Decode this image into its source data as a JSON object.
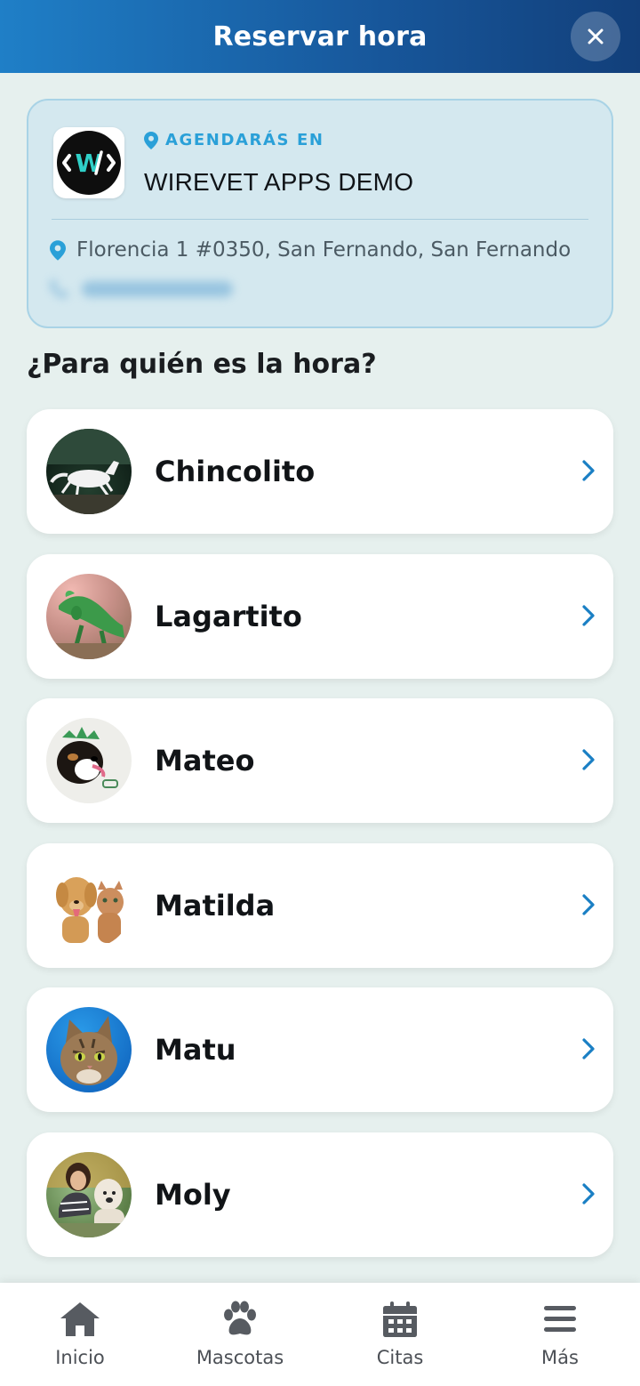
{
  "header": {
    "title": "Reservar hora",
    "close_icon": "close-icon"
  },
  "clinic": {
    "label": "AGENDARÁS EN",
    "name": "WIREVET APPS DEMO",
    "address": "Florencia 1 #0350, San Fernando, San Fernando",
    "logo_text": "W",
    "accent_color": "#2aa0d8"
  },
  "question": "¿Para quién es la hora?",
  "pets": [
    {
      "name": "Chincolito",
      "avatar": "horse-photo"
    },
    {
      "name": "Lagartito",
      "avatar": "iguana-photo"
    },
    {
      "name": "Mateo",
      "avatar": "dog-photo"
    },
    {
      "name": "Matilda",
      "avatar": "dog-and-cat-photo"
    },
    {
      "name": "Matu",
      "avatar": "cat-photo"
    },
    {
      "name": "Moly",
      "avatar": "woman-with-dog-photo"
    }
  ],
  "tabbar": {
    "items": [
      {
        "label": "Inicio",
        "icon": "home-icon"
      },
      {
        "label": "Mascotas",
        "icon": "paw-icon"
      },
      {
        "label": "Citas",
        "icon": "calendar-icon"
      },
      {
        "label": "Más",
        "icon": "menu-icon"
      }
    ]
  },
  "colors": {
    "header_start": "#1f7fc7",
    "header_end": "#123f7a",
    "chevron": "#1a7fc4",
    "background": "#e6f0ee"
  }
}
